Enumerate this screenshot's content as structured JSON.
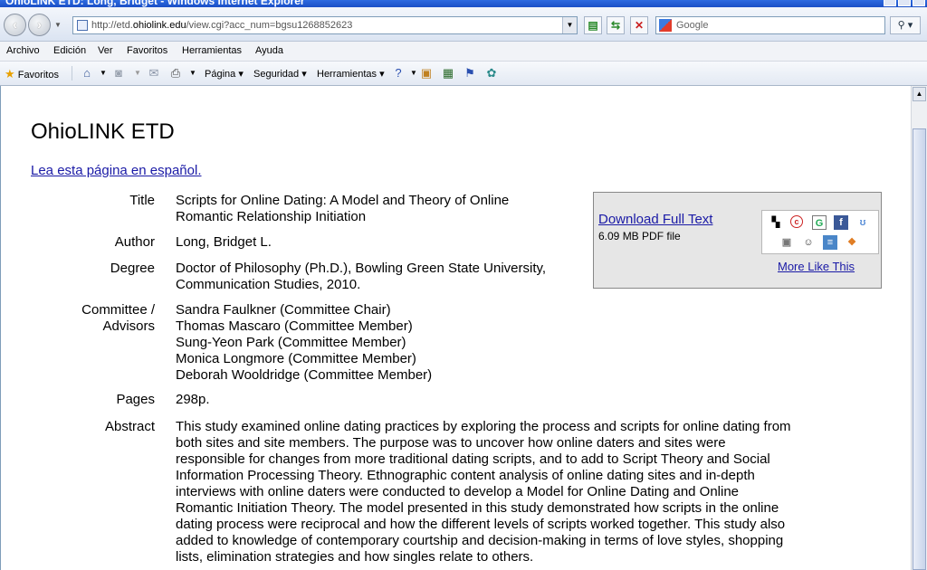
{
  "window": {
    "title": "OhioLINK ETD: Long, Bridget - Windows Internet Explorer"
  },
  "address": {
    "url_prefix": "http://etd.",
    "url_domain": "ohiolink.edu",
    "url_rest": "/view.cgi?acc_num=bgsu1268852623"
  },
  "search": {
    "placeholder": "Google"
  },
  "menu": [
    "Archivo",
    "Edición",
    "Ver",
    "Favoritos",
    "Herramientas",
    "Ayuda"
  ],
  "command_bar": {
    "favorites": "Favoritos",
    "page": "Página",
    "security": "Seguridad",
    "tools": "Herramientas"
  },
  "page": {
    "site_title": "OhioLINK ETD",
    "spanish_link": "Lea esta página en español.",
    "labels": {
      "title": "Title",
      "author": "Author",
      "degree": "Degree",
      "committee_1": "Committee /",
      "committee_2": "Advisors",
      "pages": "Pages",
      "abstract": "Abstract"
    },
    "title_lines": [
      "Scripts for Online Dating: A Model and Theory of Online",
      "Romantic Relationship Initiation"
    ],
    "author": "Long, Bridget L.",
    "degree_lines": [
      "Doctor of Philosophy (Ph.D.), Bowling Green State University,",
      "Communication Studies, 2010."
    ],
    "committee": [
      "Sandra Faulkner (Committee Chair)",
      "Thomas Mascaro (Committee Member)",
      "Sung-Yeon Park (Committee Member)",
      "Monica Longmore (Committee Member)",
      "Deborah Wooldridge (Committee Member)"
    ],
    "pages": "298p.",
    "abstract_lines": [
      "This study examined online dating practices by exploring the process and scripts for online dating from",
      "both sites and site members. The purpose was to uncover how online daters and sites were",
      "responsible for changes from more traditional dating scripts, and to add to Script Theory and Social",
      "Information Processing Theory. Ethnographic content analysis of online dating sites and in-depth",
      "interviews with online daters were conducted to develop a Model for Online Dating and Online",
      "Romantic Initiation Theory. The model presented in this study demonstrated how scripts in the online",
      "dating process were reciprocal and how the different levels of scripts worked together. This study also",
      "added to knowledge of contemporary courtship and decision-making in terms of love styles, shopping",
      "lists, elimination strategies and how singles relate to others."
    ],
    "download": {
      "link": "Download Full Text",
      "size": "6.09 MB PDF file",
      "more": "More Like This"
    }
  },
  "colors": {
    "link": "#1a1aa6",
    "download_box_bg": "#e6e6e6"
  }
}
